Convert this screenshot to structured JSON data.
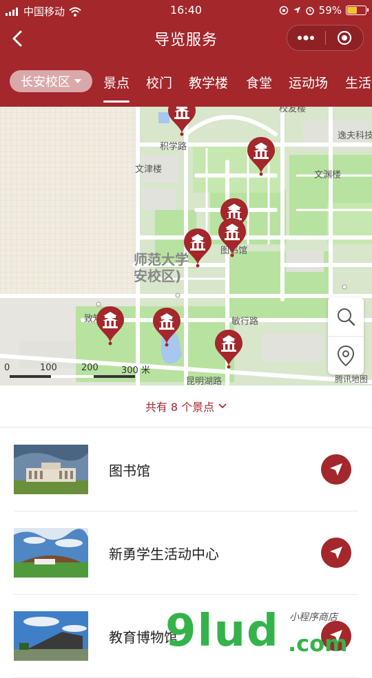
{
  "status": {
    "carrier": "中国移动",
    "time": "16:40",
    "battery_pct": "59%",
    "battery_level": 0.59
  },
  "nav": {
    "title": "导览服务"
  },
  "tabs": {
    "campus": "长安校区",
    "items": [
      "景点",
      "校门",
      "教学楼",
      "食堂",
      "运动场",
      "生活"
    ],
    "active_index": 0
  },
  "map": {
    "labels": {
      "top_road": "校友楼",
      "jilu": "积学路",
      "yifu": "逸夫科技",
      "wenjin": "文津楼",
      "wenyuan": "文渊楼",
      "library": "图书馆",
      "campus_name_1": "师范大学",
      "campus_name_2": "安校区)",
      "zhiyuan": "致知",
      "minxing": "敏行路",
      "kunming": "昆明湖路"
    },
    "scale_labels": [
      "0",
      "100",
      "200",
      "300 米"
    ],
    "provider": "腾讯地图"
  },
  "summary": {
    "count_text": "共有 8 个景点"
  },
  "spots": [
    {
      "name": "图书馆"
    },
    {
      "name": "新勇学生活动中心"
    },
    {
      "name": "教育博物馆"
    }
  ],
  "watermark": {
    "brand": "9lud",
    "suffix": ".com",
    "script": "小程序商店"
  },
  "colors": {
    "brand": "#a3272b",
    "pill": "#d9a9aa",
    "road": "#ffffff",
    "green": "#b8e2a0"
  }
}
